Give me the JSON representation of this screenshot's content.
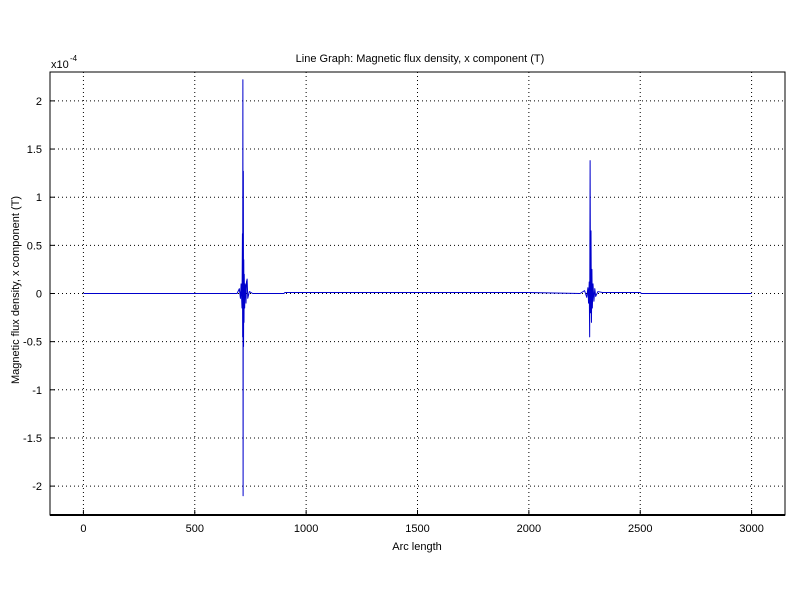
{
  "chart_data": {
    "type": "line",
    "title": "Line Graph: Magnetic flux density, x component (T)",
    "xlabel": "Arc length",
    "ylabel": "Magnetic flux density, x component (T)",
    "y_exponent_base": "x10",
    "y_exponent_power": "-4",
    "y_scale": 0.0001,
    "xlim": [
      -150,
      3150
    ],
    "ylim": [
      -2.3,
      2.3
    ],
    "x_ticks": [
      0,
      500,
      1000,
      1500,
      2000,
      2500,
      3000
    ],
    "x_tick_labels": [
      "0",
      "500",
      "1000",
      "1500",
      "2000",
      "2500",
      "3000"
    ],
    "y_ticks": [
      -2,
      -1.5,
      -1,
      -0.5,
      0,
      0.5,
      1,
      1.5,
      2
    ],
    "y_tick_labels": [
      "-2",
      "-1.5",
      "-1",
      "-0.5",
      "0",
      "0.5",
      "1",
      "1.5",
      "2"
    ],
    "grid": true,
    "line_color": "#0000cc",
    "series": [
      {
        "x": [
          0,
          690,
          700,
          705,
          708,
          712,
          714,
          715,
          716,
          717,
          718,
          719,
          720,
          721,
          722,
          724,
          726,
          728,
          730,
          732,
          735,
          738,
          745,
          760,
          900,
          905,
          1500,
          2000,
          2230,
          2250,
          2260,
          2265,
          2268,
          2271,
          2273,
          2275,
          2277,
          2279,
          2281,
          2283,
          2285,
          2288,
          2292,
          2296,
          2300,
          2310,
          2330,
          2500,
          2505,
          3000
        ],
        "y": [
          0,
          0,
          0.05,
          -0.05,
          0.1,
          -0.15,
          0.62,
          -0.45,
          2.22,
          -2.1,
          1.27,
          -0.55,
          0.35,
          -0.3,
          0.2,
          -0.15,
          0.1,
          0.08,
          -0.1,
          0.12,
          0.15,
          -0.05,
          0.02,
          0,
          0,
          0.01,
          0.01,
          0.01,
          0,
          0.03,
          -0.04,
          0.06,
          -0.1,
          0.12,
          -0.45,
          1.38,
          -0.2,
          0.65,
          -0.3,
          0.25,
          -0.15,
          0.1,
          -0.08,
          0.05,
          -0.03,
          0.02,
          0.01,
          0.01,
          0,
          0
        ]
      }
    ]
  }
}
